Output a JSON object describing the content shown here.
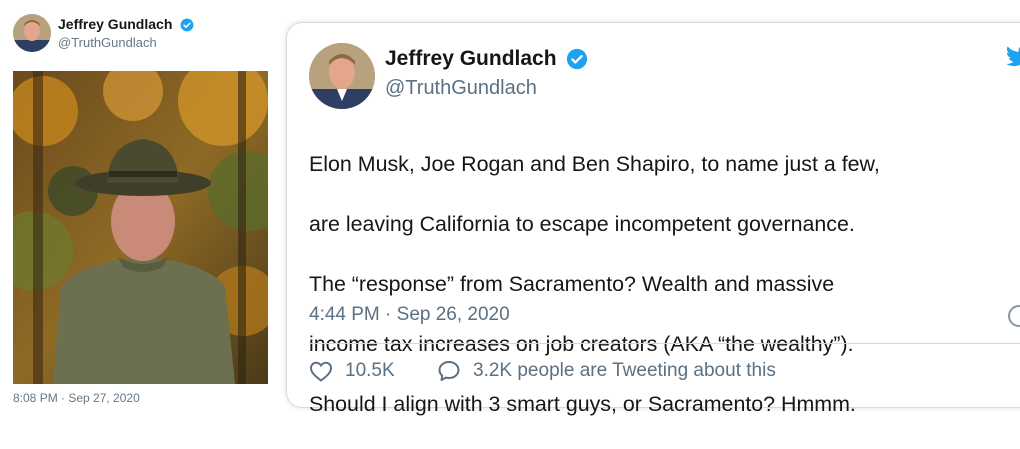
{
  "left_tweet": {
    "name": "Jeffrey Gundlach",
    "handle": "@TruthGundlach",
    "timestamp": "8:08 PM · Sep 27, 2020"
  },
  "main_tweet": {
    "name": "Jeffrey Gundlach",
    "handle": "@TruthGundlach",
    "text_lines": [
      "Elon Musk, Joe Rogan and Ben Shapiro, to name just a few,",
      "are leaving California to escape incompetent governance.",
      "The “response” from Sacramento?  Wealth and massive",
      "income tax increases on job creators (AKA “the wealthy”).",
      "Should I align with 3 smart guys, or Sacramento? Hmmm."
    ],
    "timestamp": "4:44 PM · Sep 26, 2020",
    "likes": "10.5K",
    "tweeting_about": "3.2K people are Tweeting about this"
  },
  "colors": {
    "verified": "#1da1f2",
    "twitter_brand": "#1da1f2",
    "secondary_text": "#5b7083"
  },
  "icons": [
    "verified-badge-icon",
    "twitter-bird-icon",
    "heart-icon",
    "speech-bubble-icon",
    "info-icon"
  ]
}
